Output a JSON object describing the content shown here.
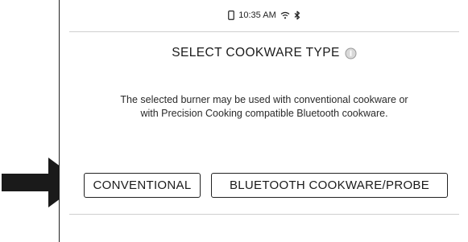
{
  "status_bar": {
    "time": "10:35 AM",
    "icons": [
      "phone-icon",
      "wifi-icon",
      "bluetooth-icon"
    ]
  },
  "dialog": {
    "title": "SELECT COOKWARE TYPE",
    "info_icon": "info-icon",
    "description": "The selected burner may be used with conventional cookware or with Precision Cooking compatible Bluetooth cookware."
  },
  "buttons": {
    "conventional": "CONVENTIONAL",
    "bluetooth": "BLUETOOTH COOKWARE/PROBE"
  },
  "annotation": {
    "pointer": "arrow-pointer-icon",
    "color": "#1a1a1a"
  }
}
